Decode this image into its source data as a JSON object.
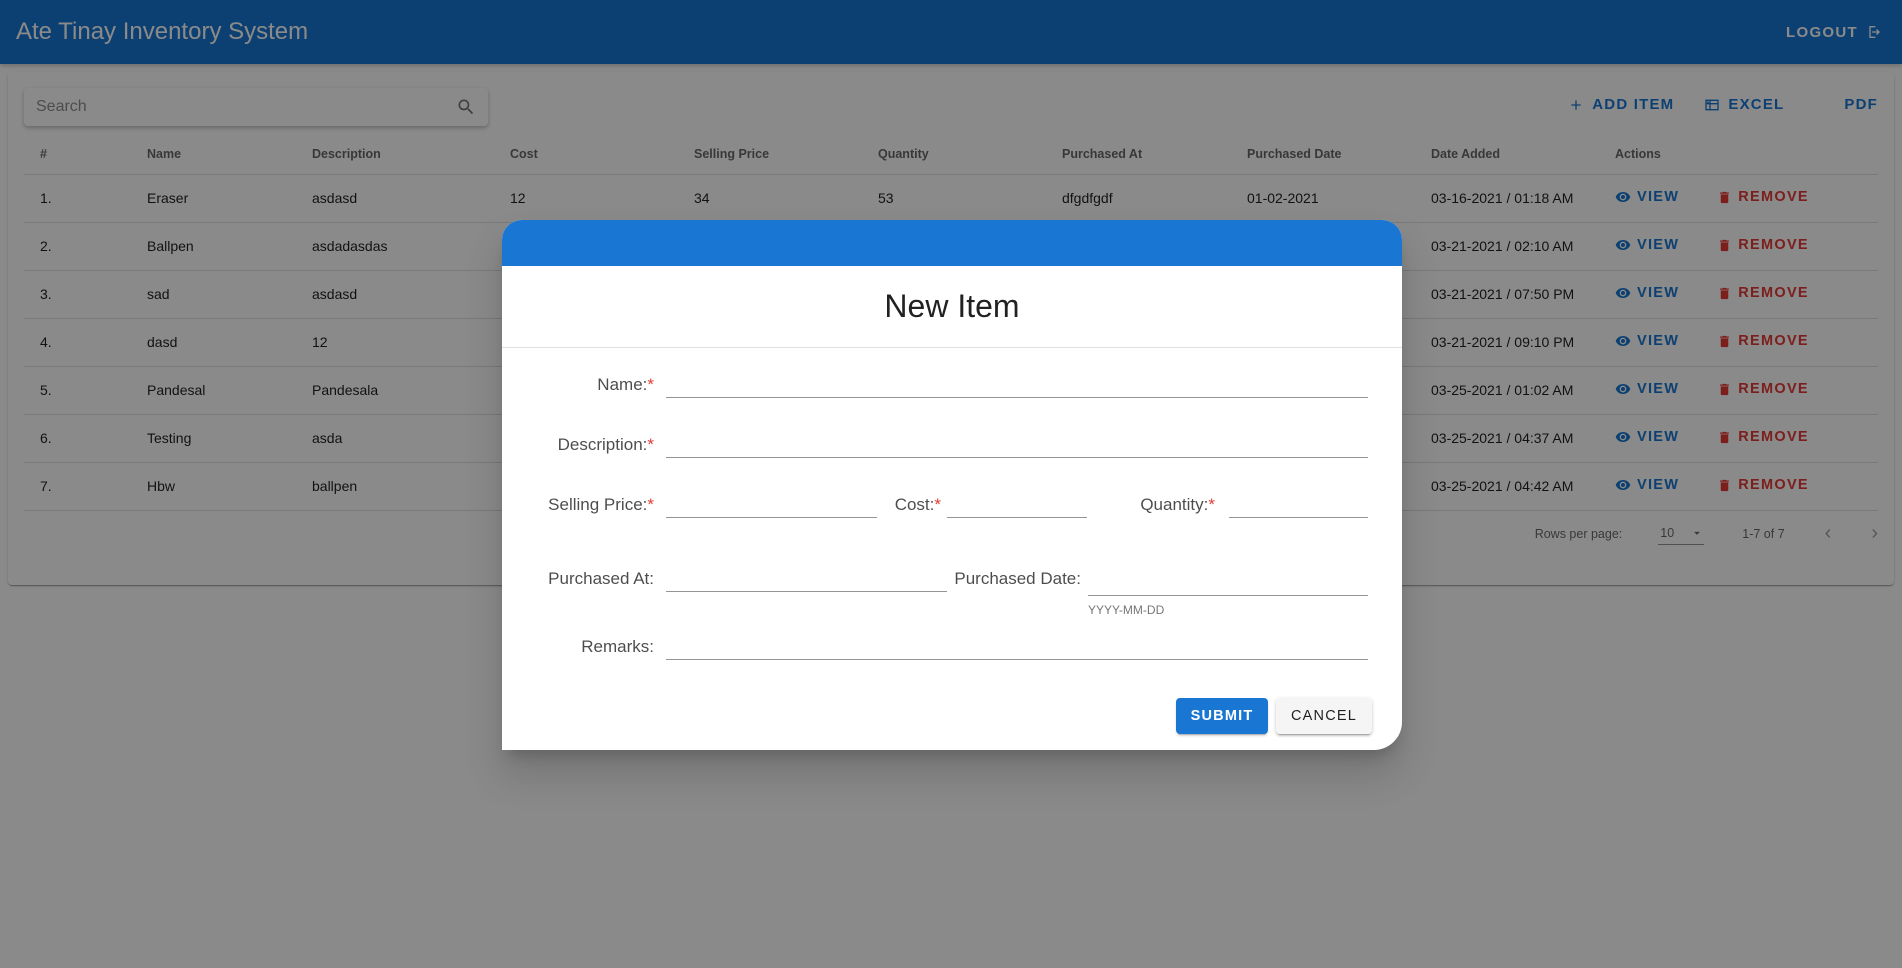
{
  "app": {
    "title": "Ate Tinay Inventory System",
    "logout_label": "LOGOUT"
  },
  "search": {
    "placeholder": "Search"
  },
  "toolbar": {
    "add_label": "ADD ITEM",
    "excel_label": "EXCEL",
    "pdf_label": "PDF"
  },
  "table": {
    "headers": [
      "#",
      "Name",
      "Description",
      "Cost",
      "Selling Price",
      "Quantity",
      "Purchased At",
      "Purchased Date",
      "Date Added",
      "Actions"
    ],
    "rows": [
      [
        "1.",
        "Eraser",
        "asdasd",
        "12",
        "34",
        "53",
        "dfgdfgdf",
        "01-02-2021",
        "03-16-2021 / 01:18 AM"
      ],
      [
        "2.",
        "Ballpen",
        "asdadasdas",
        "",
        "",
        "",
        "",
        "",
        "03-21-2021 / 02:10 AM"
      ],
      [
        "3.",
        "sad",
        "asdasd",
        "",
        "",
        "",
        "",
        "",
        "03-21-2021 / 07:50 PM"
      ],
      [
        "4.",
        "dasd",
        "12",
        "",
        "",
        "",
        "",
        "",
        "03-21-2021 / 09:10 PM"
      ],
      [
        "5.",
        "Pandesal",
        "Pandesala",
        "",
        "",
        "",
        "",
        "",
        "03-25-2021 / 01:02 AM"
      ],
      [
        "6.",
        "Testing",
        "asda",
        "",
        "",
        "",
        "",
        "",
        "03-25-2021 / 04:37 AM"
      ],
      [
        "7.",
        "Hbw",
        "ballpen",
        "",
        "",
        "",
        "",
        "",
        "03-25-2021 / 04:42 AM"
      ]
    ],
    "view_label": "VIEW",
    "remove_label": "REMOVE"
  },
  "pagination": {
    "rows_per_page_label": "Rows per page:",
    "rows_per_page": "10",
    "range": "1-7 of 7"
  },
  "dialog": {
    "title": "New Item",
    "name_label": "Name:",
    "description_label": "Description:",
    "selling_price_label": "Selling Price:",
    "cost_label": "Cost:",
    "quantity_label": "Quantity:",
    "purchased_at_label": "Purchased At:",
    "purchased_date_label": "Purchased Date:",
    "purchased_date_hint": "YYYY-MM-DD",
    "remarks_label": "Remarks:",
    "required_mark": "*",
    "submit_label": "SUBMIT",
    "cancel_label": "CANCEL"
  },
  "colors": {
    "primary": "#1976d2",
    "danger": "#e53935",
    "overlay": "rgba(0,0,0,0.46)"
  },
  "icons": [
    "logout-icon",
    "search-icon",
    "plus-icon",
    "excel-icon",
    "eye-icon",
    "trash-icon",
    "caret-down-icon",
    "chevron-left-icon",
    "chevron-right-icon"
  ]
}
